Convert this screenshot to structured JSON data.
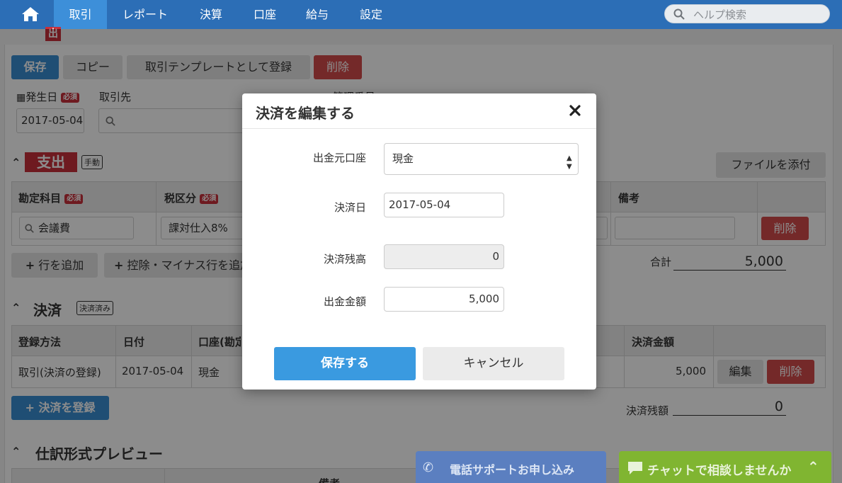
{
  "nav": {
    "items": [
      "取引",
      "レポート",
      "決算",
      "口座",
      "給与",
      "設定"
    ],
    "search_placeholder": "ヘルプ検索"
  },
  "page": {
    "corner_badge": "出",
    "buttons": {
      "save": "保存",
      "copy": "コピー",
      "template": "取引テンプレートとして登録",
      "delete": "削除"
    },
    "date_label": "発生日",
    "required_badge": "必須",
    "partner_label": "取引先",
    "mgmt_label": "管理番号",
    "date_value": "2017-05-04",
    "expense_title": "支出",
    "manual_badge": "手動",
    "attach_button": "ファイルを添付",
    "table_headers": {
      "account": "勘定科目",
      "tax": "税区分",
      "memo": "備考"
    },
    "row": {
      "account": "会議費",
      "tax": "課対仕入8%",
      "delete": "削除"
    },
    "add_row": "行を追加",
    "add_deduction": "控除・マイナス行を追加",
    "total_label": "合計",
    "total_value": "5,000",
    "settlement_title": "決済",
    "settled_badge": "決済済み",
    "settlement_headers": {
      "method": "登録方法",
      "date": "日付",
      "account": "口座(勘定科目)",
      "amount": "決済金額"
    },
    "settlement_row": {
      "method": "取引(決済の登録)",
      "date": "2017-05-04",
      "account": "現金",
      "amount": "5,000",
      "edit": "編集",
      "delete": "削除"
    },
    "register_settlement": "決済を登録",
    "balance_label": "決済残額",
    "balance_value": "0",
    "preview_title": "仕訳形式プレビュー",
    "preview_header": "備考"
  },
  "modal": {
    "title": "決済を編集する",
    "fields": {
      "account_label": "出金元口座",
      "account_value": "現金",
      "date_label": "決済日",
      "date_value": "2017-05-04",
      "balance_label": "決済残高",
      "balance_value": "0",
      "amount_label": "出金金額",
      "amount_value": "5,000"
    },
    "save": "保存する",
    "cancel": "キャンセル"
  },
  "widgets": {
    "phone": "電話サポートお申し込み",
    "chat": "チャットで相談しませんか"
  }
}
